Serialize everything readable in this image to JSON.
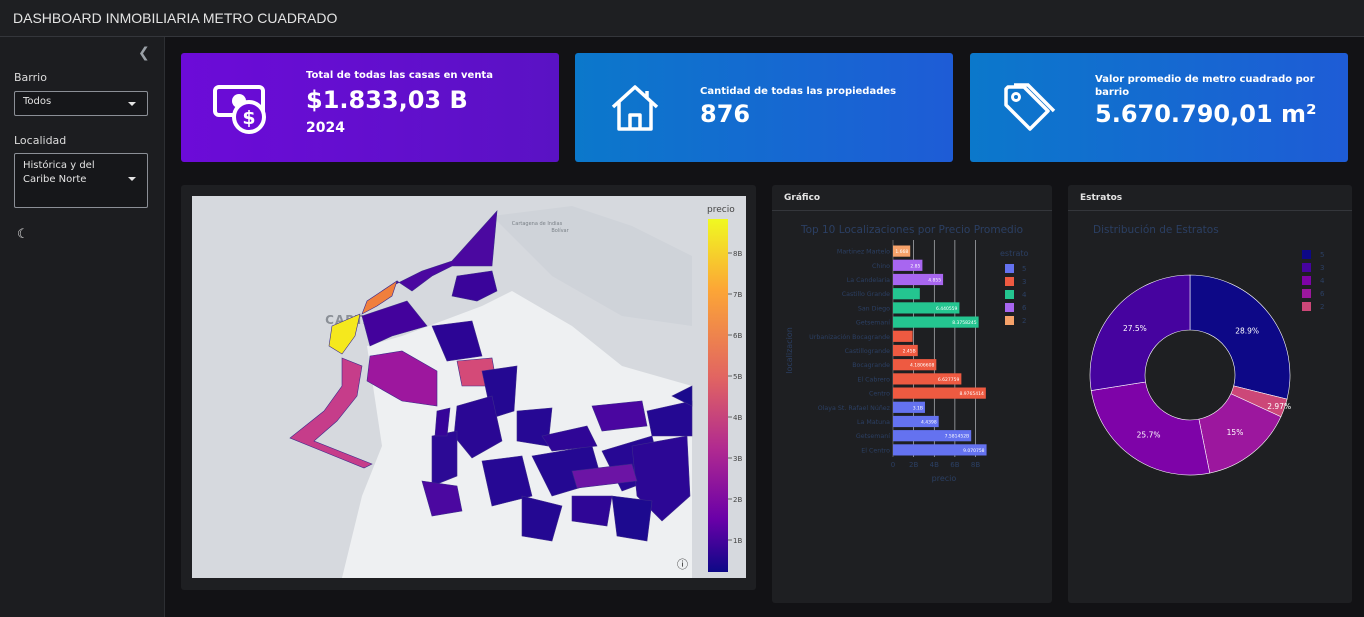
{
  "header": {
    "title": "DASHBOARD INMOBILIARIA METRO CUADRADO"
  },
  "sidebar": {
    "collapse_icon": "chevron-left-icon",
    "barrio_label": "Barrio",
    "barrio_value": "Todos",
    "localidad_label": "Localidad",
    "localidad_value": "Histórica y del Caribe Norte",
    "theme_icon": "moon-icon"
  },
  "cards": [
    {
      "title": "Total de todas las casas en venta",
      "value": "$1.833,03 B",
      "sub": "2024",
      "icon": "money-icon",
      "color": "#6a0dd6"
    },
    {
      "title": "Cantidad de todas las propiedades",
      "value": "876",
      "icon": "house-icon",
      "color": "#1d6fd1"
    },
    {
      "title": "Valor promedio de metro cuadrado por barrio",
      "value": "5.670.790,01 m²",
      "icon": "price-tag-icon",
      "color": "#1d6fd1"
    }
  ],
  "map": {
    "colorbar_title": "precio",
    "colorbar_ticks": [
      "8B",
      "7B",
      "6B",
      "5B",
      "4B",
      "3B",
      "2B",
      "1B"
    ],
    "base_label": "CARTAGENA",
    "base_sublabel1": "Cartagena de Indias",
    "base_sublabel2": "Bolívar",
    "info_icon": "info-icon"
  },
  "grafico": {
    "header": "Gráfico",
    "chart_data": {
      "type": "bar",
      "orientation": "horizontal",
      "title": "Top 10 Localizaciones por Precio Promedio",
      "xlabel": "precio",
      "ylabel": "localizacion",
      "xticks": [
        "0",
        "2B",
        "4B",
        "6B",
        "8B"
      ],
      "xlim": [
        0,
        9.5
      ],
      "categories": [
        "Martinez Martelo",
        "Chino",
        "La Candelaria",
        "Castillo Grande",
        "San Diego",
        "Getsemaní",
        "Urbanización Bocagrande",
        "Castillogrande",
        "Bocagrande",
        "El Cabrero",
        "Centro",
        "Olaya St. Rafael Núñez",
        "La Matuna",
        "Getsemaní",
        "El Centro"
      ],
      "values": [
        1.668,
        2.85,
        4.855,
        2.6,
        6.44,
        8.3,
        1.9,
        2.4,
        4.2,
        6.627,
        9.0,
        3.1,
        4.43,
        7.58,
        9.07
      ],
      "estrato": [
        2,
        6,
        6,
        4,
        4,
        4,
        3,
        3,
        3,
        3,
        3,
        5,
        5,
        5,
        5
      ],
      "labels": [
        "1.668",
        "2.85",
        "4.855",
        "",
        "6.440559",
        "8.3758245",
        "",
        "2.45B",
        "4.1806608",
        "6.627759",
        "8.9765414",
        "3.1B",
        "4.4398",
        "7.581452B",
        "9.070758"
      ],
      "legend_title": "estrato",
      "legend": [
        {
          "name": "5",
          "color": "#6472f0"
        },
        {
          "name": "3",
          "color": "#ee5a41"
        },
        {
          "name": "4",
          "color": "#24c590"
        },
        {
          "name": "6",
          "color": "#a866f0"
        },
        {
          "name": "2",
          "color": "#f6a26a"
        }
      ]
    }
  },
  "estratos": {
    "header": "Estratos",
    "chart_data": {
      "type": "pie",
      "hole": 0.45,
      "title": "Distribución de Estratos",
      "slices": [
        {
          "label": "5",
          "value": 28.9,
          "color": "#0d0887"
        },
        {
          "label": "2",
          "value": 2.97,
          "color": "#cc4778"
        },
        {
          "label": "6",
          "value": 15,
          "color": "#9c179e"
        },
        {
          "label": "4",
          "value": 25.7,
          "color": "#7e03a8"
        },
        {
          "label": "3",
          "value": 27.5,
          "color": "#46039f"
        }
      ],
      "pct_labels": [
        "28.9%",
        "2.97%",
        "15%",
        "25.7%",
        "27.5%"
      ],
      "legend": [
        {
          "name": "5",
          "color": "#0d0887"
        },
        {
          "name": "3",
          "color": "#46039f"
        },
        {
          "name": "4",
          "color": "#7e03a8"
        },
        {
          "name": "6",
          "color": "#9c179e"
        },
        {
          "name": "2",
          "color": "#cc4778"
        }
      ]
    }
  }
}
